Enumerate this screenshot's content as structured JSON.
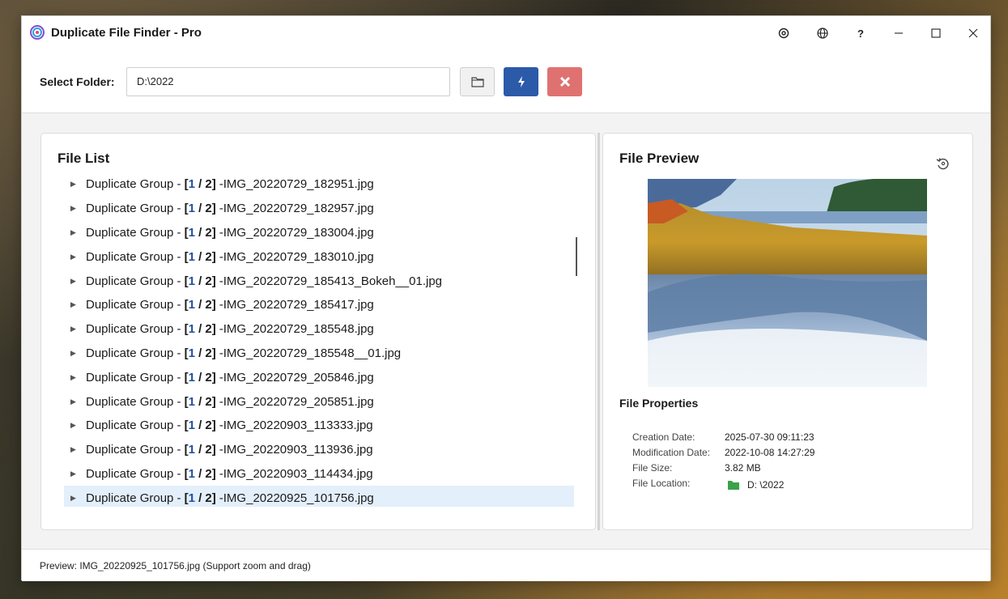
{
  "window": {
    "title": "Duplicate File Finder - Pro",
    "controls": {
      "settings_icon": "gear-icon",
      "language_icon": "globe-icon",
      "help_label": "?",
      "minimize_icon": "minimize-icon",
      "maximize_icon": "maximize-icon",
      "close_icon": "close-icon"
    }
  },
  "toolbar": {
    "folder_label": "Select Folder:",
    "folder_value": "D:\\2022",
    "browse_icon": "folder-icon",
    "scan_icon": "lightning-icon",
    "stop_icon": "x-icon",
    "scan_color": "#2b5aa8",
    "stop_color": "#e07171"
  },
  "file_list": {
    "title": "File List",
    "group_prefix": "Duplicate Group -",
    "items": [
      {
        "count_a": "1",
        "count_b": "2",
        "filename": "IMG_20220729_182951.jpg",
        "selected": false
      },
      {
        "count_a": "1",
        "count_b": "2",
        "filename": "IMG_20220729_182957.jpg",
        "selected": false
      },
      {
        "count_a": "1",
        "count_b": "2",
        "filename": "IMG_20220729_183004.jpg",
        "selected": false
      },
      {
        "count_a": "1",
        "count_b": "2",
        "filename": "IMG_20220729_183010.jpg",
        "selected": false
      },
      {
        "count_a": "1",
        "count_b": "2",
        "filename": "IMG_20220729_185413_Bokeh__01.jpg",
        "selected": false
      },
      {
        "count_a": "1",
        "count_b": "2",
        "filename": "IMG_20220729_185417.jpg",
        "selected": false
      },
      {
        "count_a": "1",
        "count_b": "2",
        "filename": "IMG_20220729_185548.jpg",
        "selected": false
      },
      {
        "count_a": "1",
        "count_b": "2",
        "filename": "IMG_20220729_185548__01.jpg",
        "selected": false
      },
      {
        "count_a": "1",
        "count_b": "2",
        "filename": "IMG_20220729_205846.jpg",
        "selected": false
      },
      {
        "count_a": "1",
        "count_b": "2",
        "filename": "IMG_20220729_205851.jpg",
        "selected": false
      },
      {
        "count_a": "1",
        "count_b": "2",
        "filename": "IMG_20220903_113333.jpg",
        "selected": false
      },
      {
        "count_a": "1",
        "count_b": "2",
        "filename": "IMG_20220903_113936.jpg",
        "selected": false
      },
      {
        "count_a": "1",
        "count_b": "2",
        "filename": "IMG_20220903_114434.jpg",
        "selected": false
      },
      {
        "count_a": "1",
        "count_b": "2",
        "filename": "IMG_20220925_101756.jpg",
        "selected": true
      }
    ]
  },
  "preview": {
    "title": "File Preview",
    "refresh_icon": "rotate-icon",
    "properties_title": "File Properties",
    "properties": {
      "creation_label": "Creation Date:",
      "creation_value": "2025-07-30 09:11:23",
      "modification_label": "Modification Date:",
      "modification_value": "2022-10-08 14:27:29",
      "size_label": "File Size:",
      "size_value": "3.82 MB",
      "location_label": "File Location:",
      "location_value": "D: \\2022",
      "location_icon": "folder-icon"
    }
  },
  "status": {
    "text": "Preview: IMG_20220925_101756.jpg (Support zoom and drag)"
  }
}
